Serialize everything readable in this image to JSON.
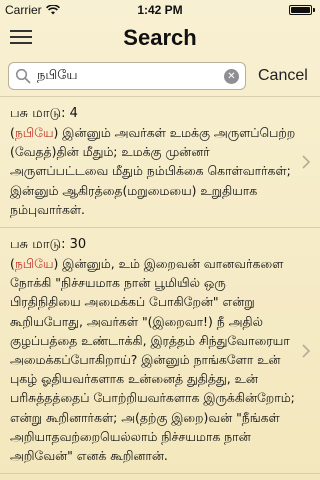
{
  "status_bar": {
    "carrier": "Carrier",
    "time": "1:42 PM"
  },
  "header": {
    "title": "Search"
  },
  "search": {
    "value": "நபியே",
    "cancel_label": "Cancel"
  },
  "results": [
    {
      "reference": "பசு மாடு: 4",
      "open_paren": "(",
      "highlight": "நபியே",
      "text": ") இன்னும் அவர்கள் உமக்கு அருளப்பெற்ற (வேதத்)தின் மீதும்; உமக்கு முன்னர் அருளப்பட்டவை மீதும் நம்பிக்கை கொள்வார்கள்; இன்னும் ஆகிரத்தை(மறுமையை) உறுதியாக நம்புவார்கள்."
    },
    {
      "reference": "பசு மாடு: 30",
      "open_paren": "(",
      "highlight": "நபியே",
      "text": ") இன்னும், உம் இறைவன் வானவர்களை நோக்கி \"நிச்சயமாக நான் பூமியில் ஒரு பிரதிநிதியை அமைக்கப் போகிறேன்\" என்று கூறியபோது, அவர்கள் \"(இறைவா!) நீ அதில் குழப்பத்தை உண்டாக்கி, இரத்தம் சிந்துவோரையா அமைக்கப்போகிறாய்? இன்னும் நாங்களோ உன் புகழ் ஓதியவர்களாக உன்னைத் துதித்து, உன் பரிசுத்தத்தைப் போற்றியவர்களாக இருக்கின்றோம்; என்று கூறினார்கள்; அ(தற்கு இறை)வன் \"நீங்கள் அறியாதவற்றையெல்லாம் நிச்சயமாக நான் அறிவேன்\" எனக் கூறினான்."
    }
  ],
  "colors": {
    "background": "#f6edc9",
    "highlight": "#c0392b",
    "separator": "#d8cfae"
  },
  "icons": {
    "menu": "hamburger-icon",
    "search": "magnifier-icon",
    "clear": "clear-circle-icon",
    "disclosure": "chevron-right-icon",
    "wifi": "wifi-icon",
    "battery": "battery-icon"
  },
  "battery_level": 1.0
}
